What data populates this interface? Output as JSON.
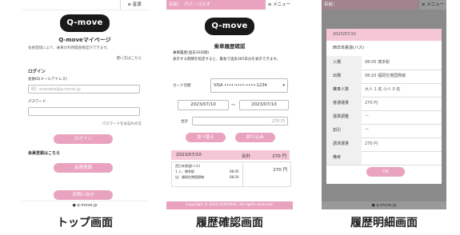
{
  "captions": {
    "top": "トップ画面",
    "history": "履歴確認画面",
    "detail": "履歴明細画面"
  },
  "s1": {
    "menu": "≡ 音源",
    "logo": "Q-move",
    "title": "Q-moveマイページ",
    "intro": "会員登録により、乗車の利用履歴確認ができます。",
    "howto": "使い方はこちら",
    "login_heading": "ログイン",
    "id_label": "会員ID(メールアドレス)",
    "id_placeholder": "例）example@q-move.jp",
    "pw_label": "パスワード",
    "forgot": "パスワードをお忘れの方",
    "login_btn": "ログイン",
    "register_heading": "会員登録はこちら",
    "register_btn": "会員登録",
    "contact_btn": "お問い合せ",
    "footer": "q-move.jp"
  },
  "s2": {
    "name_label": "名前：",
    "name_value": "パパ・パスオ",
    "menu": "≡ メニュー",
    "logo": "Q-move",
    "title": "乗車履歴確認",
    "desc1": "乗車履歴(過去30日間)",
    "desc2": "表示する期間を指定すると、最長で過去365日分を表示できます。",
    "card_label": "カード切替",
    "card_value": "VISA ••••-••••-••••-1234",
    "date_from": "2023/07/10",
    "date_sep": "〜",
    "date_to": "2023/07/10",
    "total_label": "合計",
    "total_value": "270 円",
    "sort_btn": "並べ替え",
    "filter_btn": "絞り込み",
    "list_date": "2023/07/10",
    "list_total_label": "合計",
    "list_total_value": "270 円",
    "item_line1": "西日本鉄道(バス)",
    "item_line2": "1 入：博多駅",
    "item_line2_time": "08:05",
    "item_line3": "出：福岡空港国際線",
    "item_line3_time": "08:20",
    "item_amount": "270 円",
    "copyright": "Copyright © 2020 QUADRAC. All rights reserved."
  },
  "s3": {
    "name_label": "名前：",
    "menu": "≡ メニュー",
    "date": "2023/07/10",
    "operator": "西日本鉄道(バス)",
    "rows": [
      {
        "k": "入場",
        "v": "08:05 博多駅"
      },
      {
        "k": "出場",
        "v": "08:20 福岡空港国際線"
      },
      {
        "k": "乗車人数",
        "v": "大人 1 名  小人 0 名"
      },
      {
        "k": "普通運賃",
        "v": "270 円"
      },
      {
        "k": "運賃調整",
        "v": "ー"
      },
      {
        "k": "割引",
        "v": "ー"
      },
      {
        "k": "請求運賃",
        "v": "270 円"
      },
      {
        "k": "備考",
        "v": ""
      }
    ],
    "ok_btn": "OK",
    "footer": "q-move.jp"
  }
}
